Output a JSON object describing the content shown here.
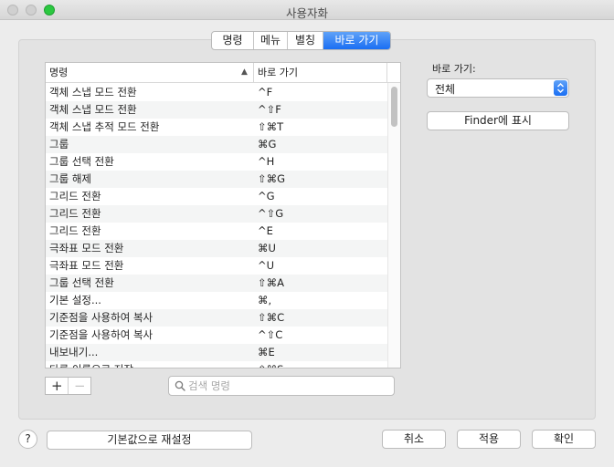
{
  "window": {
    "title": "사용자화"
  },
  "tabs": [
    {
      "label": "명령",
      "active": false
    },
    {
      "label": "메뉴",
      "active": false
    },
    {
      "label": "별칭",
      "active": false
    },
    {
      "label": "바로 가기",
      "active": true
    }
  ],
  "table": {
    "headers": {
      "command": "명령",
      "shortcut": "바로 가기"
    },
    "rows": [
      {
        "command": "객체 스냅 모드 전환",
        "shortcut": "^F"
      },
      {
        "command": "객체 스냅 모드 전환",
        "shortcut": "^⇧F"
      },
      {
        "command": "객체 스냅 추적 모드 전환",
        "shortcut": "⇧⌘T"
      },
      {
        "command": "그룹",
        "shortcut": "⌘G"
      },
      {
        "command": "그룹 선택 전환",
        "shortcut": "^H"
      },
      {
        "command": "그룹 해제",
        "shortcut": "⇧⌘G"
      },
      {
        "command": "그리드 전환",
        "shortcut": "^G"
      },
      {
        "command": "그리드 전환",
        "shortcut": "^⇧G"
      },
      {
        "command": "그리드 전환",
        "shortcut": "^E"
      },
      {
        "command": "극좌표 모드 전환",
        "shortcut": "⌘U"
      },
      {
        "command": "극좌표 모드 전환",
        "shortcut": "^U"
      },
      {
        "command": "그룹 선택 전환",
        "shortcut": "⇧⌘A"
      },
      {
        "command": "기본 설정...",
        "shortcut": "⌘,"
      },
      {
        "command": "기준점을 사용하여 복사",
        "shortcut": "⇧⌘C"
      },
      {
        "command": "기준점을 사용하여 복사",
        "shortcut": "^⇧C"
      },
      {
        "command": "내보내기...",
        "shortcut": "⌘E"
      },
      {
        "command": "다른 이름으로 저장...",
        "shortcut": "⇧⌘S"
      }
    ]
  },
  "list_controls": {
    "add": "+",
    "remove": "−"
  },
  "search": {
    "placeholder": "검색 명령",
    "value": ""
  },
  "sidebar": {
    "filter_label": "바로 가기:",
    "filter_value": "전체",
    "finder_button": "Finder에 표시"
  },
  "footer": {
    "help": "?",
    "reset": "기본값으로 재설정",
    "cancel": "취소",
    "apply": "적용",
    "ok": "확인"
  },
  "colors": {
    "accent": "#1a6ef3",
    "zoom_light": "#2bc840"
  }
}
